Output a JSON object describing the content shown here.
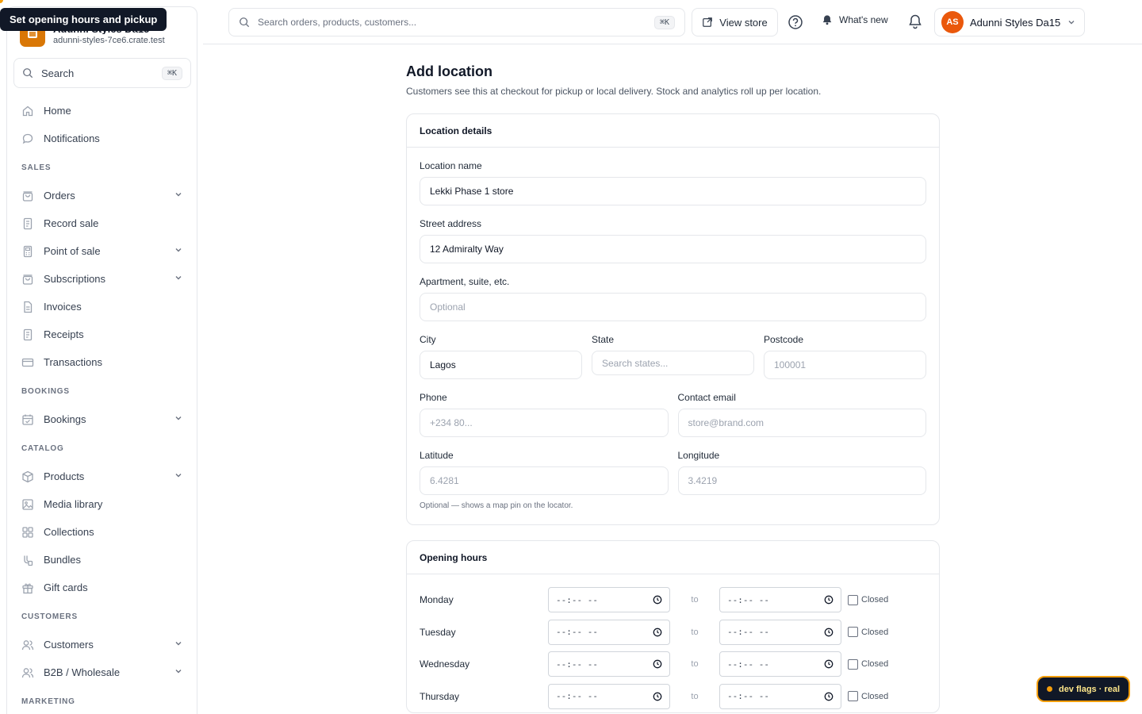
{
  "tooltip": "Set opening hours and pickup",
  "brand": {
    "name": "Adunni Styles Da15",
    "domain": "adunni-styles-7ce6.crate.test"
  },
  "sidebar": {
    "search_label": "Search",
    "search_kbd": "⌘K",
    "items_top": [
      {
        "label": "Home",
        "icon": "home-icon"
      },
      {
        "label": "Notifications",
        "icon": "chat-bubble-icon"
      }
    ],
    "sections": [
      {
        "title": "SALES",
        "items": [
          {
            "label": "Orders",
            "icon": "bag-icon",
            "expandable": true
          },
          {
            "label": "Record sale",
            "icon": "receipt-icon",
            "expandable": false
          },
          {
            "label": "Point of sale",
            "icon": "pos-icon",
            "expandable": true
          },
          {
            "label": "Subscriptions",
            "icon": "bag-icon",
            "expandable": true
          },
          {
            "label": "Invoices",
            "icon": "document-icon",
            "expandable": false
          },
          {
            "label": "Receipts",
            "icon": "receipt-icon",
            "expandable": false
          },
          {
            "label": "Transactions",
            "icon": "credit-card-icon",
            "expandable": false
          }
        ]
      },
      {
        "title": "BOOKINGS",
        "items": [
          {
            "label": "Bookings",
            "icon": "calendar-icon",
            "expandable": true
          }
        ]
      },
      {
        "title": "CATALOG",
        "items": [
          {
            "label": "Products",
            "icon": "box-icon",
            "expandable": true
          },
          {
            "label": "Media library",
            "icon": "image-icon",
            "expandable": false
          },
          {
            "label": "Collections",
            "icon": "grid-icon",
            "expandable": false
          },
          {
            "label": "Bundles",
            "icon": "bundle-icon",
            "expandable": false
          },
          {
            "label": "Gift cards",
            "icon": "gift-icon",
            "expandable": false
          }
        ]
      },
      {
        "title": "CUSTOMERS",
        "items": [
          {
            "label": "Customers",
            "icon": "users-icon",
            "expandable": true
          },
          {
            "label": "B2B / Wholesale",
            "icon": "users-icon",
            "expandable": true
          }
        ]
      },
      {
        "title": "MARKETING",
        "items": []
      }
    ]
  },
  "topbar": {
    "search_placeholder": "Search orders, products, customers...",
    "search_kbd": "⌘K",
    "view_store": "View store",
    "whats_new": "What's new",
    "account_initials": "AS",
    "account_name": "Adunni Styles Da15"
  },
  "page": {
    "title": "Add location",
    "subtitle": "Customers see this at checkout for pickup or local delivery. Stock and analytics roll up per location."
  },
  "details": {
    "heading": "Location details",
    "name_label": "Location name",
    "name_value": "Lekki Phase 1 store",
    "street_label": "Street address",
    "street_value": "12 Admiralty Way",
    "apt_label": "Apartment, suite, etc.",
    "apt_placeholder": "Optional",
    "city_label": "City",
    "city_value": "Lagos",
    "state_label": "State",
    "state_placeholder": "Search states...",
    "postcode_label": "Postcode",
    "postcode_placeholder": "100001",
    "phone_label": "Phone",
    "phone_placeholder": "+234 80...",
    "email_label": "Contact email",
    "email_placeholder": "store@brand.com",
    "lat_label": "Latitude",
    "lat_placeholder": "6.4281",
    "lng_label": "Longitude",
    "lng_placeholder": "3.4219",
    "coords_hint": "Optional — shows a map pin on the locator."
  },
  "hours": {
    "heading": "Opening hours",
    "time_placeholder": "--:-- --",
    "to_label": "to",
    "closed_label": "Closed",
    "days": [
      "Monday",
      "Tuesday",
      "Wednesday",
      "Thursday"
    ]
  },
  "dev_badge": "dev flags · real"
}
